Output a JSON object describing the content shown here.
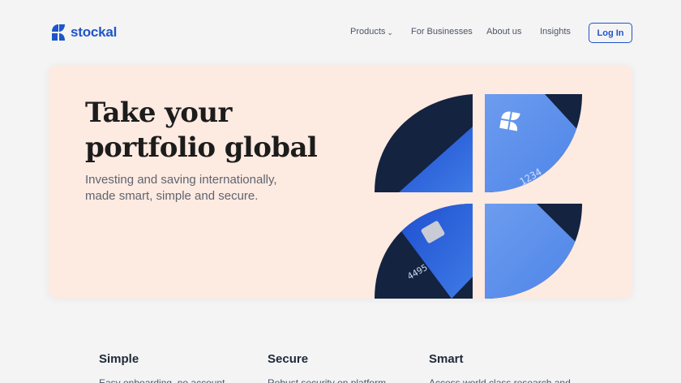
{
  "brand": {
    "name": "stockal",
    "color": "#1e55c8"
  },
  "nav": {
    "products": "Products",
    "products_icon": "chevron-down-icon",
    "for_businesses": "For Businesses",
    "about_us": "About us",
    "insights": "Insights",
    "login": "Log In"
  },
  "hero": {
    "title": "Take your portfolio global",
    "subtitle": "Investing and saving internationally, made smart, simple and secure.",
    "background": "#fdeae1",
    "card_numbers": [
      "4495",
      "1234"
    ]
  },
  "features": [
    {
      "title": "Simple",
      "text": "Easy onboarding, no account"
    },
    {
      "title": "Secure",
      "text": "Robust security on platform"
    },
    {
      "title": "Smart",
      "text": "Access world class research and"
    }
  ]
}
